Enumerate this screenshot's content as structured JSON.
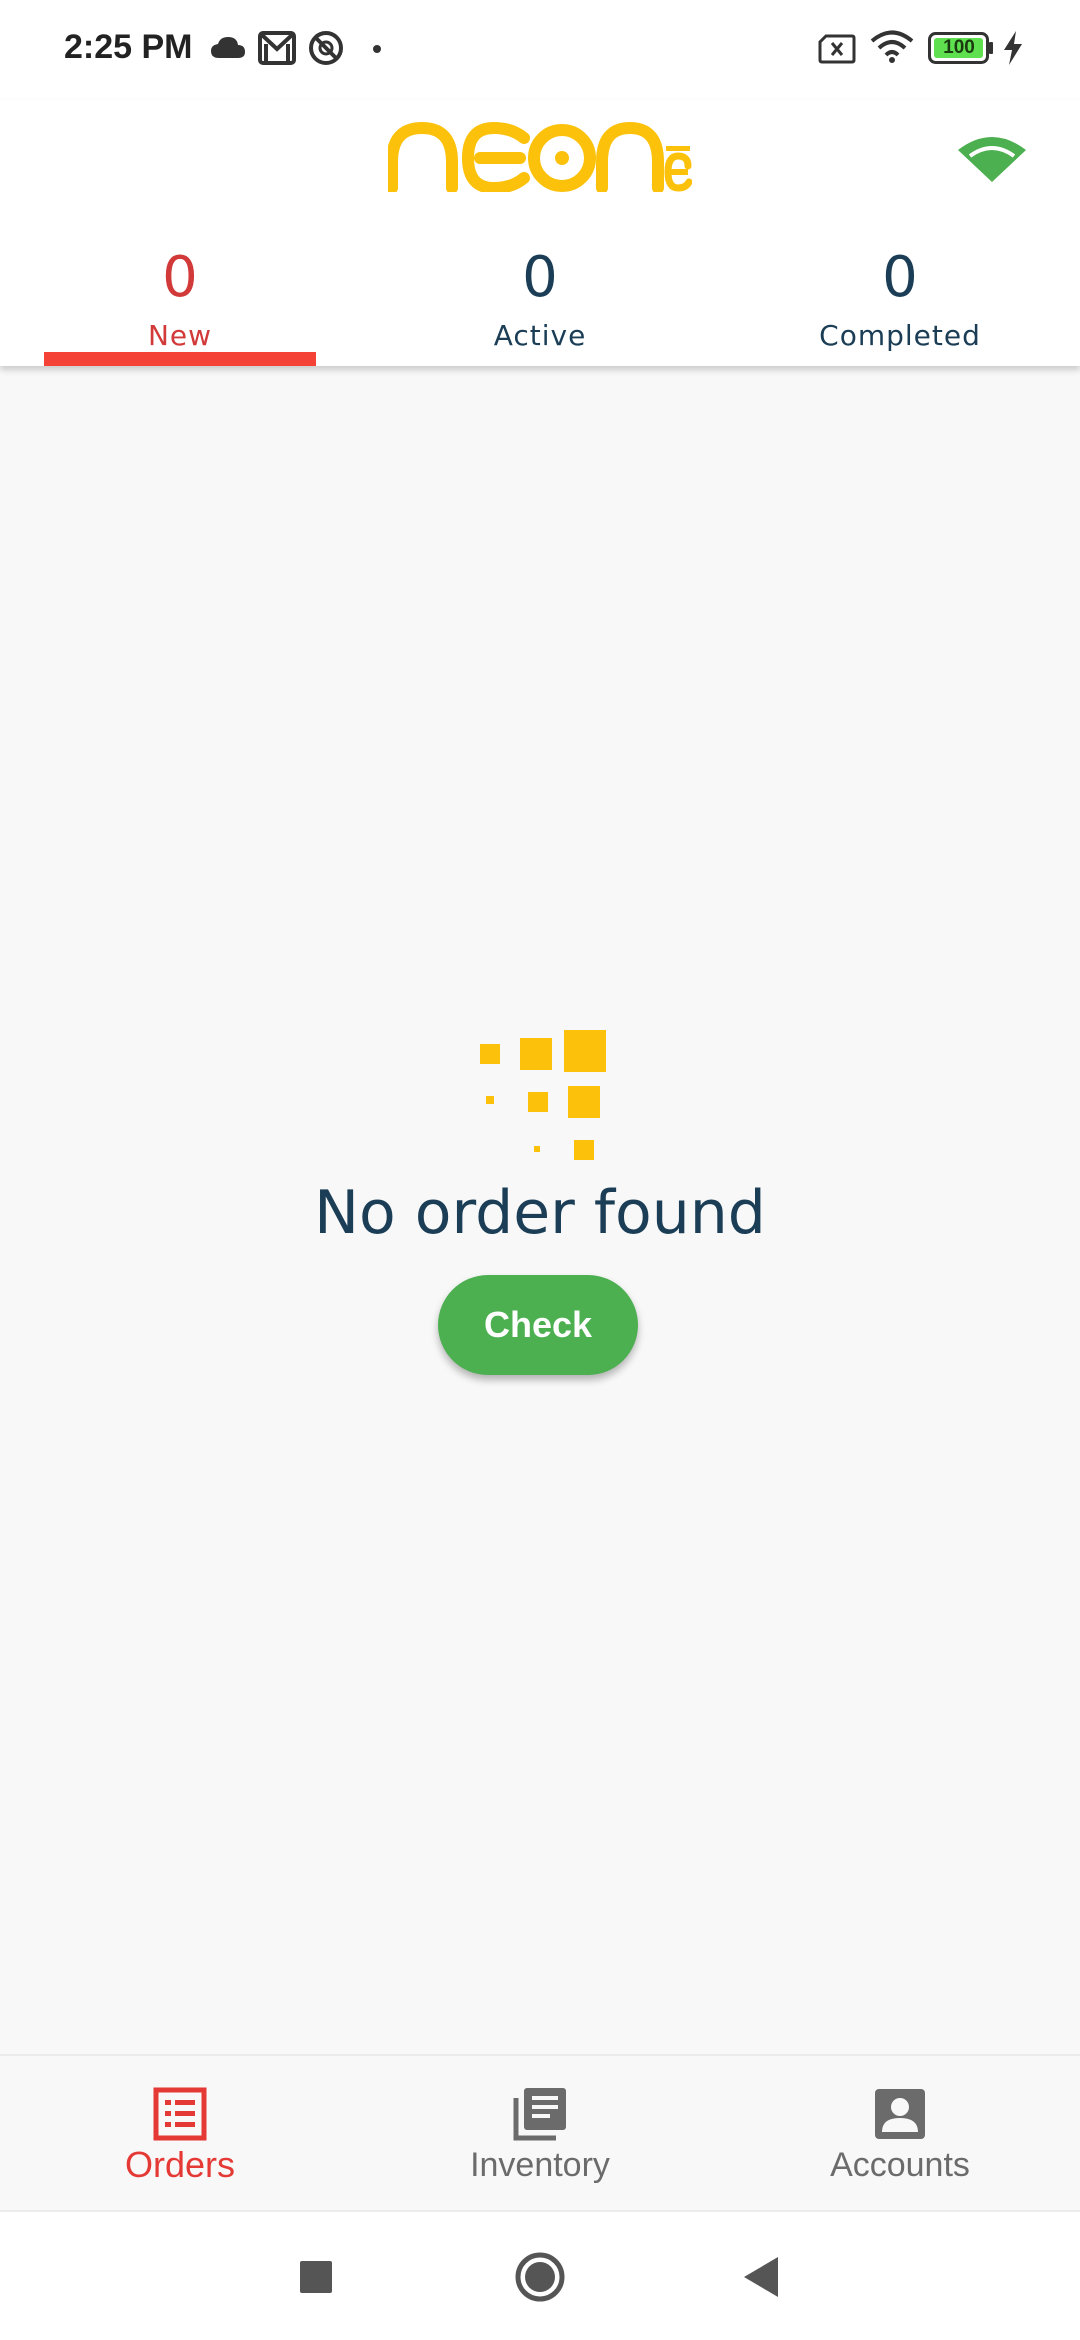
{
  "status_bar": {
    "time": "2:25 PM",
    "battery_level": "100",
    "icons": [
      "cloud-icon",
      "gmail-icon",
      "no-disturb-icon",
      "dot-icon",
      "sim-x-icon",
      "wifi-icon",
      "battery-icon",
      "charging-icon"
    ]
  },
  "header": {
    "logo_text": "neoné",
    "connection_icon": "wifi-icon",
    "colors": {
      "logo": "#fbc10b",
      "connection": "#4caf50"
    }
  },
  "tabs": [
    {
      "count": "0",
      "label": "New",
      "selected": true
    },
    {
      "count": "0",
      "label": "Active",
      "selected": false
    },
    {
      "count": "0",
      "label": "Completed",
      "selected": false
    }
  ],
  "tab_colors": {
    "selected": "#d23a3a",
    "default": "#1b3e56",
    "indicator": "#f44336"
  },
  "empty_state": {
    "illustration_icon": "pixel-squares-icon",
    "title": "No order found",
    "button_label": "Check",
    "button_color": "#4caf50"
  },
  "bottom_nav": {
    "items": [
      {
        "label": "Orders",
        "icon": "orders-list-icon",
        "selected": true
      },
      {
        "label": "Inventory",
        "icon": "inventory-library-icon",
        "selected": false
      },
      {
        "label": "Accounts",
        "icon": "account-box-icon",
        "selected": false
      }
    ],
    "colors": {
      "selected": "#e53935",
      "default": "#6b6b6b"
    }
  },
  "system_nav": {
    "icons": [
      "recent-apps-icon",
      "home-icon",
      "back-icon"
    ]
  }
}
